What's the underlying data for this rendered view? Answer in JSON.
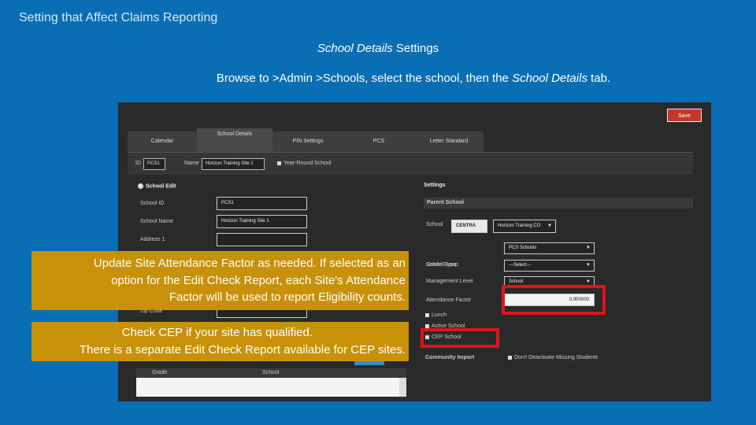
{
  "slide": {
    "title": "Setting that Affect Claims Reporting",
    "subtitle_italic": "School Details",
    "subtitle_rest": " Settings",
    "instruction_pre": "Browse to >Admin >Schools, select the school, then the ",
    "instruction_italic": "School Details",
    "instruction_post": " tab."
  },
  "app": {
    "save_label": "Save",
    "tabs": [
      {
        "label": "Calendar"
      },
      {
        "label": "School Details"
      },
      {
        "label": "PIN Settings"
      },
      {
        "label": "PCS"
      },
      {
        "label": "Letter Standard"
      }
    ],
    "id_label": "ID",
    "id_value": "PCS1",
    "name_label": "Name",
    "name_value": "Horizon Training Site 1",
    "year_round_label": "Year-Round School",
    "left_section_title": "School Edit",
    "left_fields": [
      {
        "label": "School ID",
        "value": "PCS1"
      },
      {
        "label": "School Name",
        "value": "Horizon Training Site 1"
      },
      {
        "label": "Address 1",
        "value": ""
      }
    ],
    "zip_label": "Zip Code",
    "grade_header": "Grade",
    "school_header": "School",
    "right_section_title": "Settings",
    "parent_school_label": "Parent School",
    "school_label": "School",
    "school_code": "CENTRA",
    "school_select": "Horizon Training CO",
    "settings_rows": [
      {
        "label": "School Type",
        "value": "PCS Schools"
      },
      {
        "label": "Grade Group",
        "value": "---Select---"
      },
      {
        "label": "Management Level",
        "value": "School"
      },
      {
        "label": "Attendance Factor",
        "value": "0.950000"
      }
    ],
    "checkbox_items": [
      {
        "label": "Lunch"
      },
      {
        "label": "Active School"
      },
      {
        "label": "CEP School"
      }
    ],
    "community_import_label": "Community Import",
    "dont_deactivate_label": "Don't Deactivate Missing Students"
  },
  "callouts": {
    "attendance_lines": [
      "Update Site Attendance Factor as needed. If selected as an",
      "option for the Edit Check Report, each Site's Attendance",
      "Factor will be used to report Eligibility counts."
    ],
    "cep_lines": [
      "Check CEP if your site has qualified.",
      "There is a separate Edit Check Report available for CEP sites."
    ]
  },
  "colors": {
    "slide_background": "#0a6eb4",
    "callout_background": "#c8910a",
    "highlight_border": "#e0141a",
    "save_button": "#c0392b"
  }
}
